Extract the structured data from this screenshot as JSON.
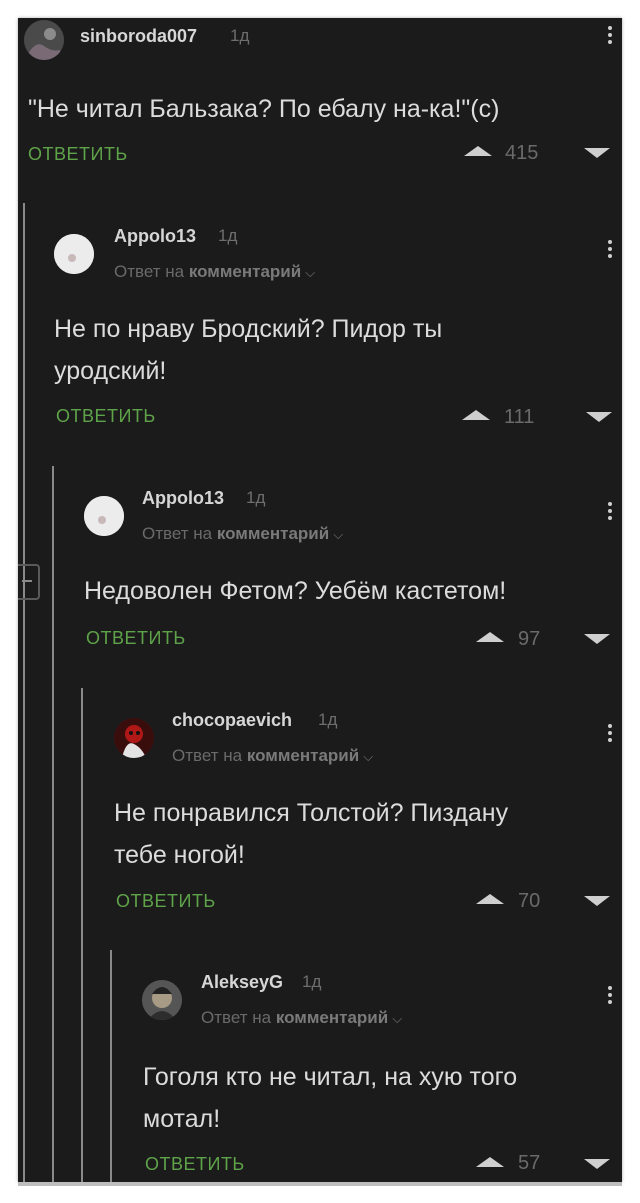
{
  "comments": [
    {
      "username": "sinboroda007",
      "time": "1д",
      "reply_prefix": "",
      "reply_link": "",
      "lines": [
        "\"Не читал Бальзака? По ебалу на-ка!\"(с)"
      ],
      "reply_label": "ОТВЕТИТЬ",
      "score": "415"
    },
    {
      "username": "Appolo13",
      "time": "1д",
      "reply_prefix": "Ответ на",
      "reply_link": "комментарий",
      "lines": [
        "Не по нраву Бродский? Пидор ты",
        "уродский!"
      ],
      "reply_label": "ОТВЕТИТЬ",
      "score": "111"
    },
    {
      "username": "Appolo13",
      "time": "1д",
      "reply_prefix": "Ответ на",
      "reply_link": "комментарий",
      "lines": [
        "Недоволен Фетом? Уебём кастетом!"
      ],
      "reply_label": "ОТВЕТИТЬ",
      "score": "97"
    },
    {
      "username": "chocopaevich",
      "time": "1д",
      "reply_prefix": "Ответ на",
      "reply_link": "комментарий",
      "lines": [
        "Не понравился Толстой? Пиздану",
        "тебе ногой!"
      ],
      "reply_label": "ОТВЕТИТЬ",
      "score": "70"
    },
    {
      "username": "AlekseyG",
      "time": "1д",
      "reply_prefix": "Ответ на",
      "reply_link": "комментарий",
      "lines": [
        "Гоголя кто не читал, на хую того",
        "мотал!"
      ],
      "reply_label": "ОТВЕТИТЬ",
      "score": "57"
    }
  ],
  "icons": {
    "menu": "kebab-menu-icon",
    "upvote": "triangle-up-icon",
    "downvote": "triangle-down-icon",
    "collapse": "minus-icon",
    "chevron": "chevron-down-icon"
  },
  "colors": {
    "background": "#1b1b1b",
    "reply_green": "#5ea349",
    "text": "#dcdcdc",
    "muted": "#6e6e6e"
  }
}
